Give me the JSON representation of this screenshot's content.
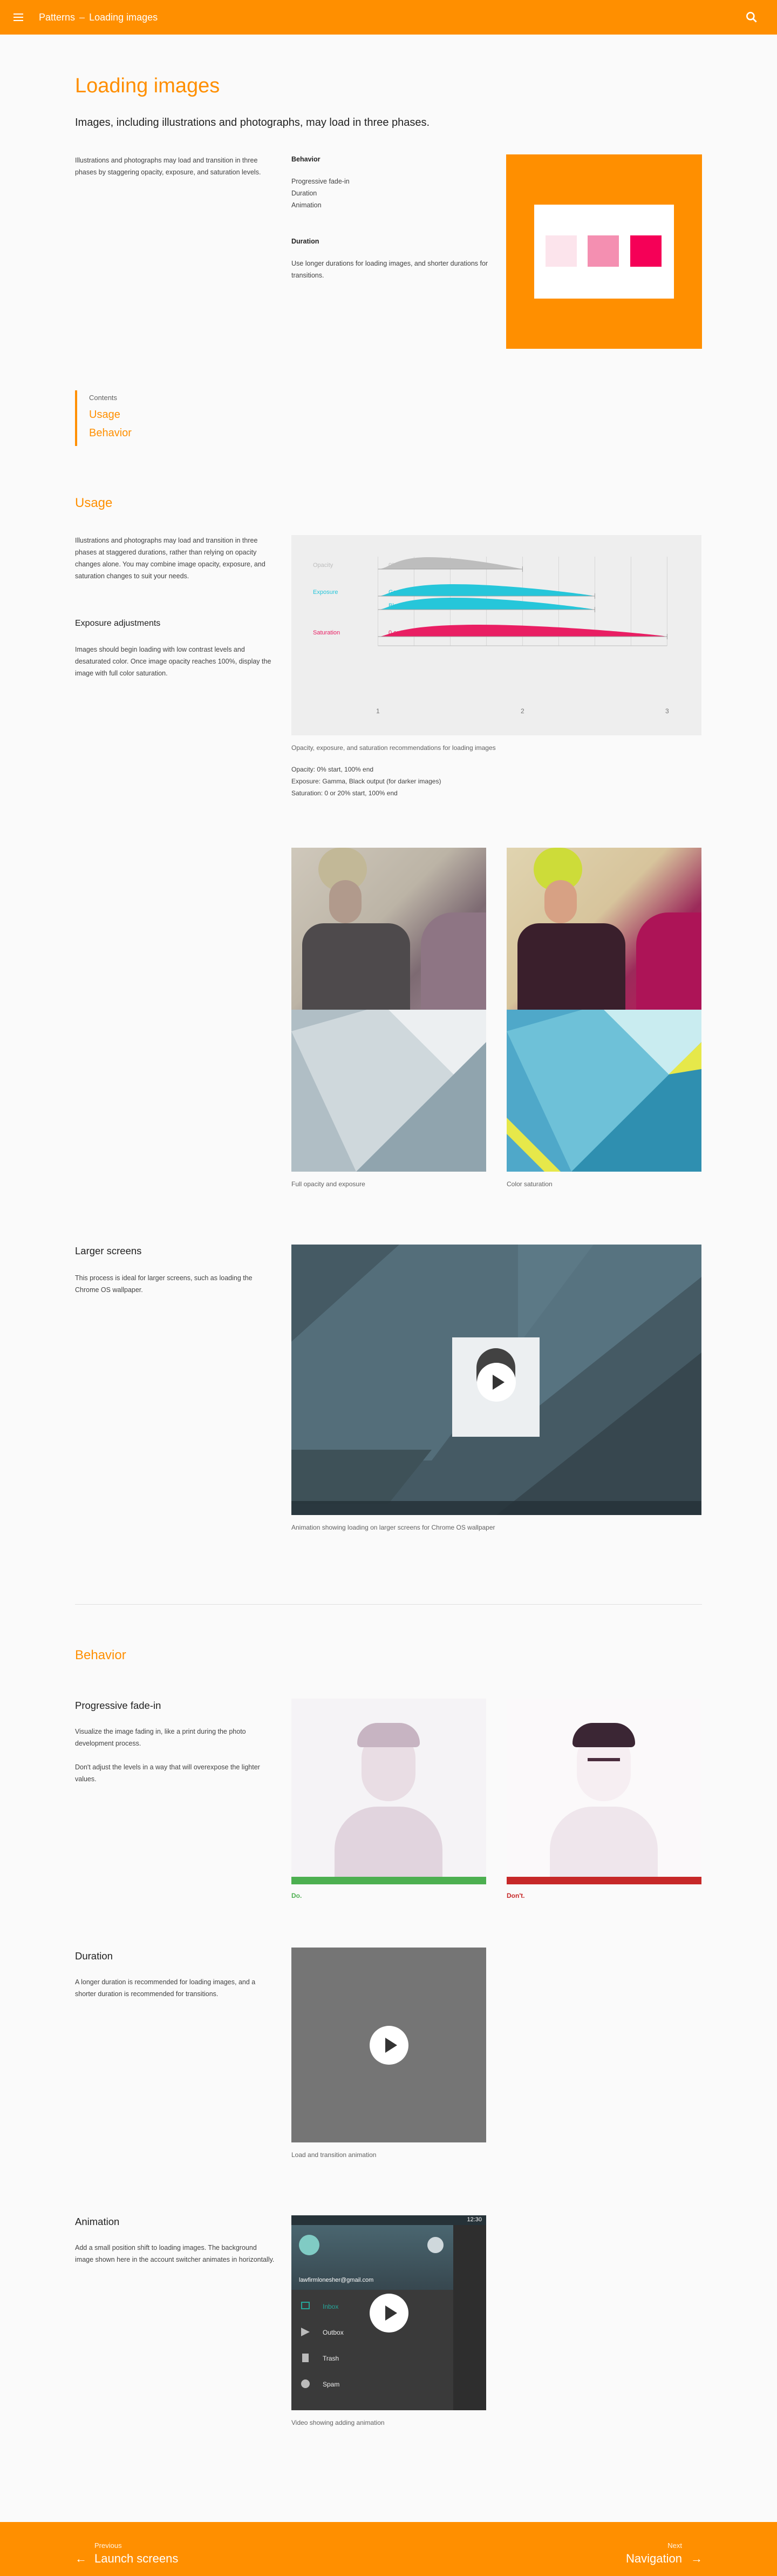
{
  "topbar": {
    "section": "Patterns",
    "separator": "–",
    "page": "Loading images"
  },
  "intro": {
    "title": "Loading images",
    "lead": "Images, including illustrations and photographs, may load in three phases.",
    "desc": "Illustrations and photographs may load and transition in three phases by staggering opacity, exposure, and saturation levels.",
    "behavior_heading": "Behavior",
    "behavior_items": [
      "Progressive fade-in",
      "Duration",
      "Animation"
    ],
    "duration_heading": "Duration",
    "duration_text": "Use longer durations for loading images, and shorter durations for transitions.",
    "swatch_colors": [
      "#fce4ec",
      "#f48fb1",
      "#f50057"
    ]
  },
  "toc": {
    "title": "Contents",
    "items": [
      "Usage",
      "Behavior"
    ]
  },
  "usage": {
    "heading": "Usage",
    "text": "Illustrations and photographs may load and transition in three phases at staggered durations, rather than relying on opacity changes alone. You may combine image opacity, exposure, and saturation changes to suit your needs.",
    "exposure_heading": "Exposure adjustments",
    "exposure_text": "Images should begin loading with low contrast levels and desaturated color. Once image opacity reaches 100%, display the image with full color saturation.",
    "chart_caption": "Opacity, exposure, and saturation recommendations for loading images",
    "chart_notes": [
      "Opacity: 0% start, 100% end",
      "Exposure: Gamma, Black output (for darker images)",
      "Saturation: 0 or 20% start, 100% end"
    ],
    "caption_left": "Full opacity and exposure",
    "caption_right": "Color saturation"
  },
  "chart_data": {
    "type": "area",
    "x_ticks": [
      "1",
      "2",
      "3"
    ],
    "xlim": [
      0.7,
      3.2
    ],
    "rows": [
      {
        "label": "Opacity",
        "desc": "0% start, 100% end",
        "color": "#bdbdbd",
        "start": 1,
        "end": 2
      },
      {
        "label": "Exposure",
        "desc": "Gamma",
        "color": "#26c6da",
        "start": 1,
        "end": 2.5
      },
      {
        "label": "",
        "desc": "Black Output (for darker images)",
        "color": "#26c6da",
        "start": 1,
        "end": 2.5
      },
      {
        "label": "Saturation",
        "desc": "0 or 20% start, 100% end",
        "color": "#e91e63",
        "start": 1,
        "end": 3
      }
    ]
  },
  "larger": {
    "heading": "Larger screens",
    "text": "This process is ideal for larger screens, such as loading the Chrome OS wallpaper.",
    "caption": "Animation showing loading on larger screens for Chrome OS wallpaper"
  },
  "behavior": {
    "heading": "Behavior",
    "fade_heading": "Progressive fade-in",
    "fade_text1": "Visualize the image fading in, like a print during the photo development process.",
    "fade_text2": "Don't adjust the levels in a way that will overexpose the lighter values.",
    "do_label": "Do.",
    "dont_label": "Don't.",
    "do_color": "#4caf50",
    "dont_color": "#c62828",
    "duration_heading": "Duration",
    "duration_text": "A longer duration is recommended for loading images, and a shorter duration is recommended for transitions.",
    "duration_caption": "Load and transition animation",
    "anim_heading": "Animation",
    "anim_text": "Add a small position shift to loading images. The background image shown here in the account switcher animates in horizontally.",
    "anim_caption": "Video showing adding animation",
    "phone": {
      "time": "12:30",
      "account": "lawfirmlonesher@gmail.com",
      "menu": [
        "Inbox",
        "Outbox",
        "Trash",
        "Spam"
      ]
    }
  },
  "footer": {
    "prev_small": "Previous",
    "prev": "Launch screens",
    "next_small": "Next",
    "next": "Navigation"
  }
}
